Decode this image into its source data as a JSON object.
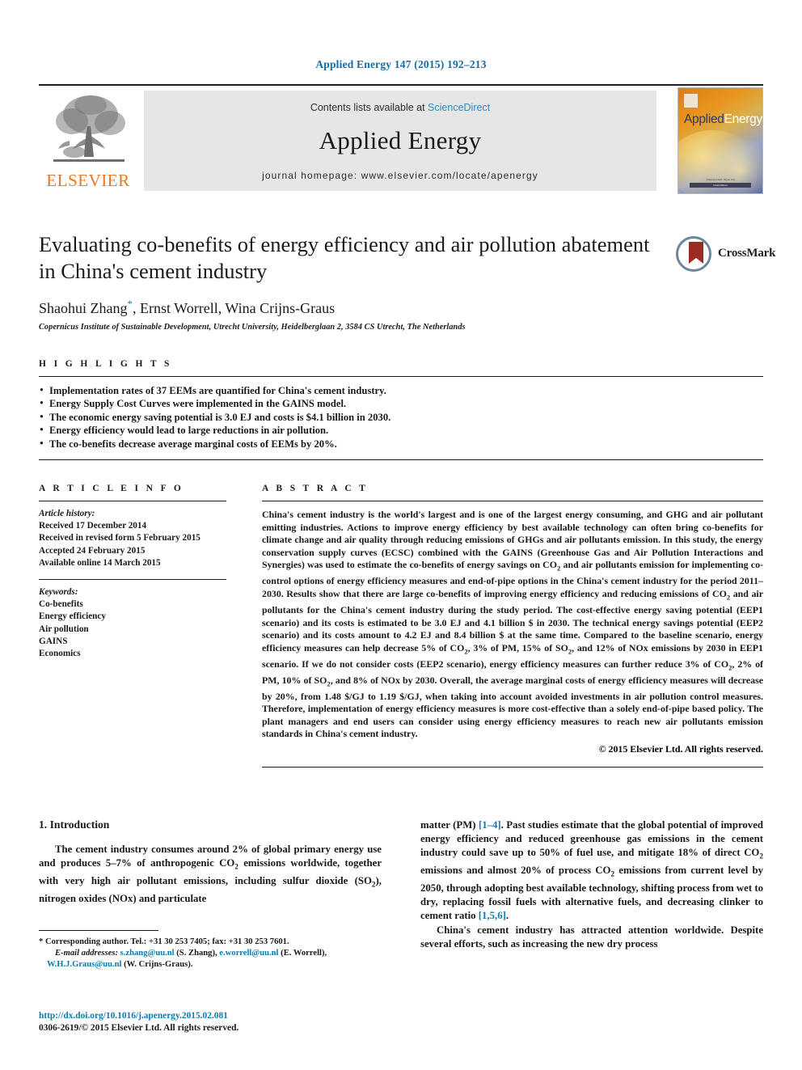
{
  "running_head": "Applied Energy 147 (2015) 192–213",
  "masthead": {
    "contents_prefix": "Contents lists available at ",
    "sciencedirect": "ScienceDirect",
    "journal_title": "Applied Energy",
    "homepage": "journal homepage: www.elsevier.com/locate/apenergy",
    "publisher_name": "ELSEVIER",
    "cover_name_a": "Applied",
    "cover_name_b": "Energy",
    "cover_footer_top": "Editor-in-Chief: Jinyue Yan",
    "cover_footer_bar": "ScienceDirect"
  },
  "article": {
    "title": "Evaluating co-benefits of energy efficiency and air pollution abatement in China's cement industry",
    "authors": "Shaohui Zhang",
    "authors_rest": ", Ernst Worrell, Wina Crijns-Graus",
    "corresponding_marker": "*",
    "affiliation": "Copernicus Institute of Sustainable Development, Utrecht University, Heidelberglaan 2, 3584 CS Utrecht, The Netherlands",
    "crossmark_label": "CrossMark"
  },
  "highlights": {
    "label": "H I G H L I G H T S",
    "items": [
      "Implementation rates of 37 EEMs are quantified for China's cement industry.",
      "Energy Supply Cost Curves were implemented in the GAINS model.",
      "The economic energy saving potential is 3.0 EJ and costs is $4.1 billion in 2030.",
      "Energy efficiency would lead to large reductions in air pollution.",
      "The co-benefits decrease average marginal costs of EEMs by 20%."
    ]
  },
  "article_info": {
    "label": "A R T I C L E   I N F O",
    "history_label": "Article history:",
    "history": [
      "Received 17 December 2014",
      "Received in revised form 5 February 2015",
      "Accepted 24 February 2015",
      "Available online 14 March 2015"
    ],
    "keywords_label": "Keywords:",
    "keywords": [
      "Co-benefits",
      "Energy efficiency",
      "Air pollution",
      "GAINS",
      "Economics"
    ]
  },
  "abstract": {
    "label": "A B S T R A C T",
    "text": "China's cement industry is the world's largest and is one of the largest energy consuming, and GHG and air pollutant emitting industries. Actions to improve energy efficiency by best available technology can often bring co-benefits for climate change and air quality through reducing emissions of GHGs and air pollutants emission. In this study, the energy conservation supply curves (ECSC) combined with the GAINS (Greenhouse Gas and Air Pollution Interactions and Synergies) was used to estimate the co-benefits of energy savings on CO2 and air pollutants emission for implementing co-control options of energy efficiency measures and end-of-pipe options in the China's cement industry for the period 2011–2030. Results show that there are large co-benefits of improving energy efficiency and reducing emissions of CO2 and air pollutants for the China's cement industry during the study period. The cost-effective energy saving potential (EEP1 scenario) and its costs is estimated to be 3.0 EJ and 4.1 billion $ in 2030. The technical energy savings potential (EEP2 scenario) and its costs amount to 4.2 EJ and 8.4 billion $ at the same time. Compared to the baseline scenario, energy efficiency measures can help decrease 5% of CO2, 3% of PM, 15% of SO2, and 12% of NOx emissions by 2030 in EEP1 scenario. If we do not consider costs (EEP2 scenario), energy efficiency measures can further reduce 3% of CO2, 2% of PM, 10% of SO2, and 8% of NOx by 2030. Overall, the average marginal costs of energy efficiency measures will decrease by 20%, from 1.48 $/GJ to 1.19 $/GJ, when taking into account avoided investments in air pollution control measures. Therefore, implementation of energy efficiency measures is more cost-effective than a solely end-of-pipe based policy. The plant managers and end users can consider using energy efficiency measures to reach new air pollutants emission standards in China's cement industry.",
    "copyright": "© 2015 Elsevier Ltd. All rights reserved."
  },
  "introduction": {
    "heading": "1. Introduction",
    "left_paragraph_1": "The cement industry consumes around 2% of global primary energy use and produces 5–7% of anthropogenic CO2 emissions worldwide, together with very high air pollutant emissions, including sulfur dioxide (SO2), nitrogen oxides (NOx) and particulate",
    "right_paragraph_1_a": "matter (PM) ",
    "right_ref_1": "[1–4]",
    "right_paragraph_1_b": ". Past studies estimate that the global potential of improved energy efficiency and reduced greenhouse gas emissions in the cement industry could save up to 50% of fuel use, and mitigate 18% of direct CO2 emissions and almost 20% of process CO2 emissions from current level by 2050, through adopting best available technology, shifting process from wet to dry, replacing fossil fuels with alternative fuels, and decreasing clinker to cement ratio ",
    "right_ref_2": "[1,5,6]",
    "right_paragraph_1_c": ".",
    "right_paragraph_2": "China's cement industry has attracted attention worldwide. Despite several efforts, such as increasing the new dry process"
  },
  "footnote": {
    "corresponding": "* Corresponding author. Tel.: +31 30 253 7405; fax: +31 30 253 7601.",
    "email_label": "E-mail addresses:",
    "email_1": "s.zhang@uu.nl",
    "email_1_owner": "(S. Zhang),",
    "email_2": "e.worrell@uu.nl",
    "email_2_owner": "(E. Worrell),",
    "email_3": "W.H.J.Graus@uu.nl",
    "email_3_owner": "(W. Crijns-Graus).",
    "doi": "http://dx.doi.org/10.1016/j.apenergy.2015.02.081",
    "issn": "0306-2619/© 2015 Elsevier Ltd. All rights reserved."
  },
  "colors": {
    "link_blue": "#0e7ab0",
    "head_blue": "#0f6ea8",
    "elsevier_orange": "#e87722",
    "masthead_gray": "#e6e6e6"
  }
}
